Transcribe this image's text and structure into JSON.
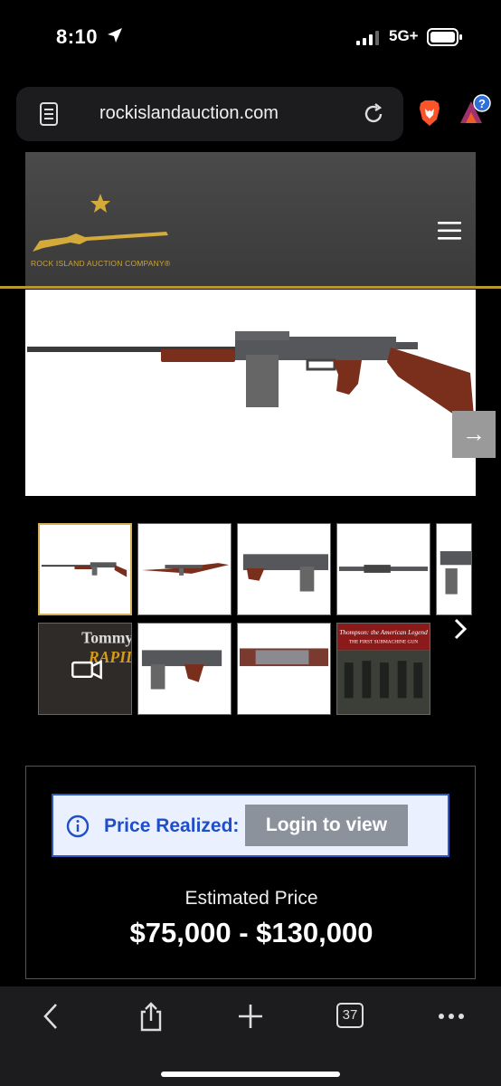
{
  "status_bar": {
    "time": "8:10",
    "network": "5G+"
  },
  "browser": {
    "url": "rockislandauction.com",
    "tab_count": "37"
  },
  "site": {
    "company_name": "ROCK ISLAND AUCTION COMPANY®",
    "brand_color": "#b8972f"
  },
  "gallery": {
    "thumbnails": [
      {
        "name": "thumb-1",
        "selected": true
      },
      {
        "name": "thumb-2"
      },
      {
        "name": "thumb-3"
      },
      {
        "name": "thumb-4"
      },
      {
        "name": "thumb-5"
      },
      {
        "name": "thumb-video",
        "caption": "Tommy"
      },
      {
        "name": "thumb-7"
      },
      {
        "name": "thumb-8"
      },
      {
        "name": "thumb-9",
        "caption": "Thompson: the American Legend",
        "caption2": "THE FIRST SUBMACHINE GUN"
      }
    ]
  },
  "price": {
    "realized_label": "Price Realized:",
    "login_label": "Login to view",
    "estimated_label": "Estimated Price",
    "estimated_value": "$75,000 - $130,000"
  }
}
